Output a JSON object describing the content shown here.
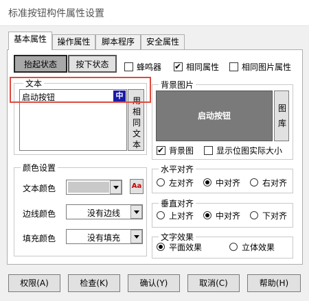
{
  "window": {
    "title": "标准按钮构件属性设置"
  },
  "tabs": [
    "基本属性",
    "操作属性",
    "脚本程序",
    "安全属性"
  ],
  "state_buttons": {
    "up": "抬起状态",
    "down": "按下状态"
  },
  "options": {
    "buzzer": "蜂鸣器",
    "same_attr": "相同属性",
    "same_image_attr": "相同图片属性"
  },
  "text_group": {
    "legend": "文本",
    "value": "启动按钮",
    "lang_badge": "中",
    "side_button": "用相同文本"
  },
  "bg_group": {
    "legend": "背景图片",
    "preview_text": "启动按钮",
    "lib_button": "图库",
    "bg_check": "背景图",
    "actual_size_check": "显示位图实际大小"
  },
  "color_group": {
    "legend": "颜色设置",
    "text_color_label": "文本颜色",
    "border_color_label": "边线颜色",
    "border_color_value": "没有边线",
    "fill_color_label": "填充颜色",
    "fill_color_value": "没有填充",
    "font_button": "Aa"
  },
  "h_align": {
    "legend": "水平对齐",
    "options": [
      "左对齐",
      "中对齐",
      "右对齐"
    ],
    "selected": "中对齐"
  },
  "v_align": {
    "legend": "垂直对齐",
    "options": [
      "上对齐",
      "中对齐",
      "下对齐"
    ],
    "selected": "中对齐"
  },
  "text_effect": {
    "legend": "文字效果",
    "options": [
      "平面效果",
      "立体效果"
    ],
    "selected": "平面效果"
  },
  "bottom_buttons": [
    "权限(A)",
    "检查(K)",
    "确认(Y)",
    "取消(C)",
    "帮助(H)"
  ],
  "colors": {
    "highlight": "#e0483c",
    "preview_bg": "#7a7a7a",
    "lang_badge": "#1a1aa8"
  }
}
